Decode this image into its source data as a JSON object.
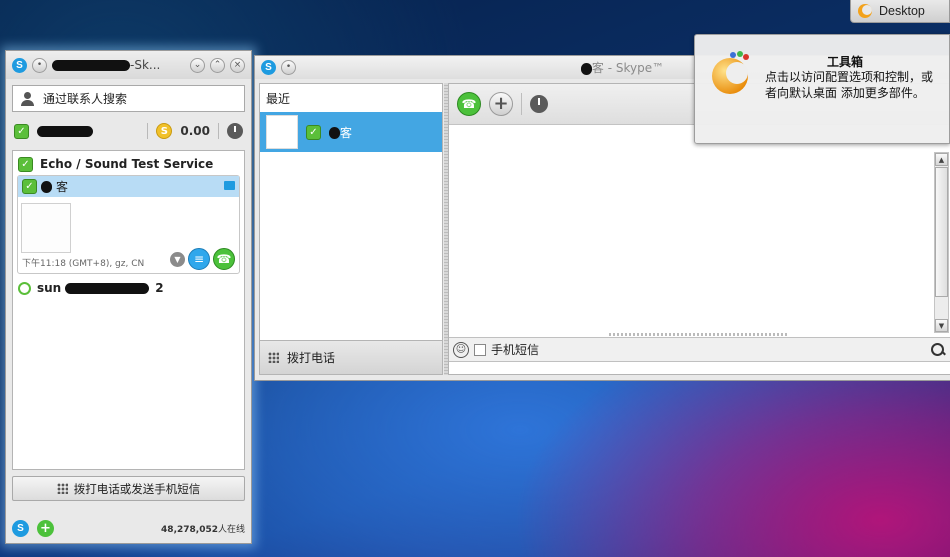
{
  "desktop_indicator": {
    "label": "Desktop"
  },
  "contacts_window": {
    "title": "-Sk...",
    "search_placeholder": "通过联系人搜索",
    "credit": "0.00",
    "contacts": [
      {
        "name": "Echo / Sound Test Service"
      },
      {
        "name": "客",
        "local_time": "下午11:18 (GMT+8), gz, CN"
      },
      {
        "name_prefix": "sun",
        "name_suffix": "2"
      }
    ],
    "dial_button": "拨打电话或发送手机短信",
    "online_count": "48,278,052",
    "online_suffix": "人在线"
  },
  "conversation_window": {
    "title": "客 - Skype™",
    "recent_header": "最近",
    "recent_items": [
      {
        "name": "客"
      }
    ],
    "dial_label": "拨打电话",
    "sms_label": "手机短信"
  },
  "toolbox": {
    "title": "工具箱",
    "body": "点击以访问配置选项和控制，或者向默认桌面 添加更多部件。"
  }
}
